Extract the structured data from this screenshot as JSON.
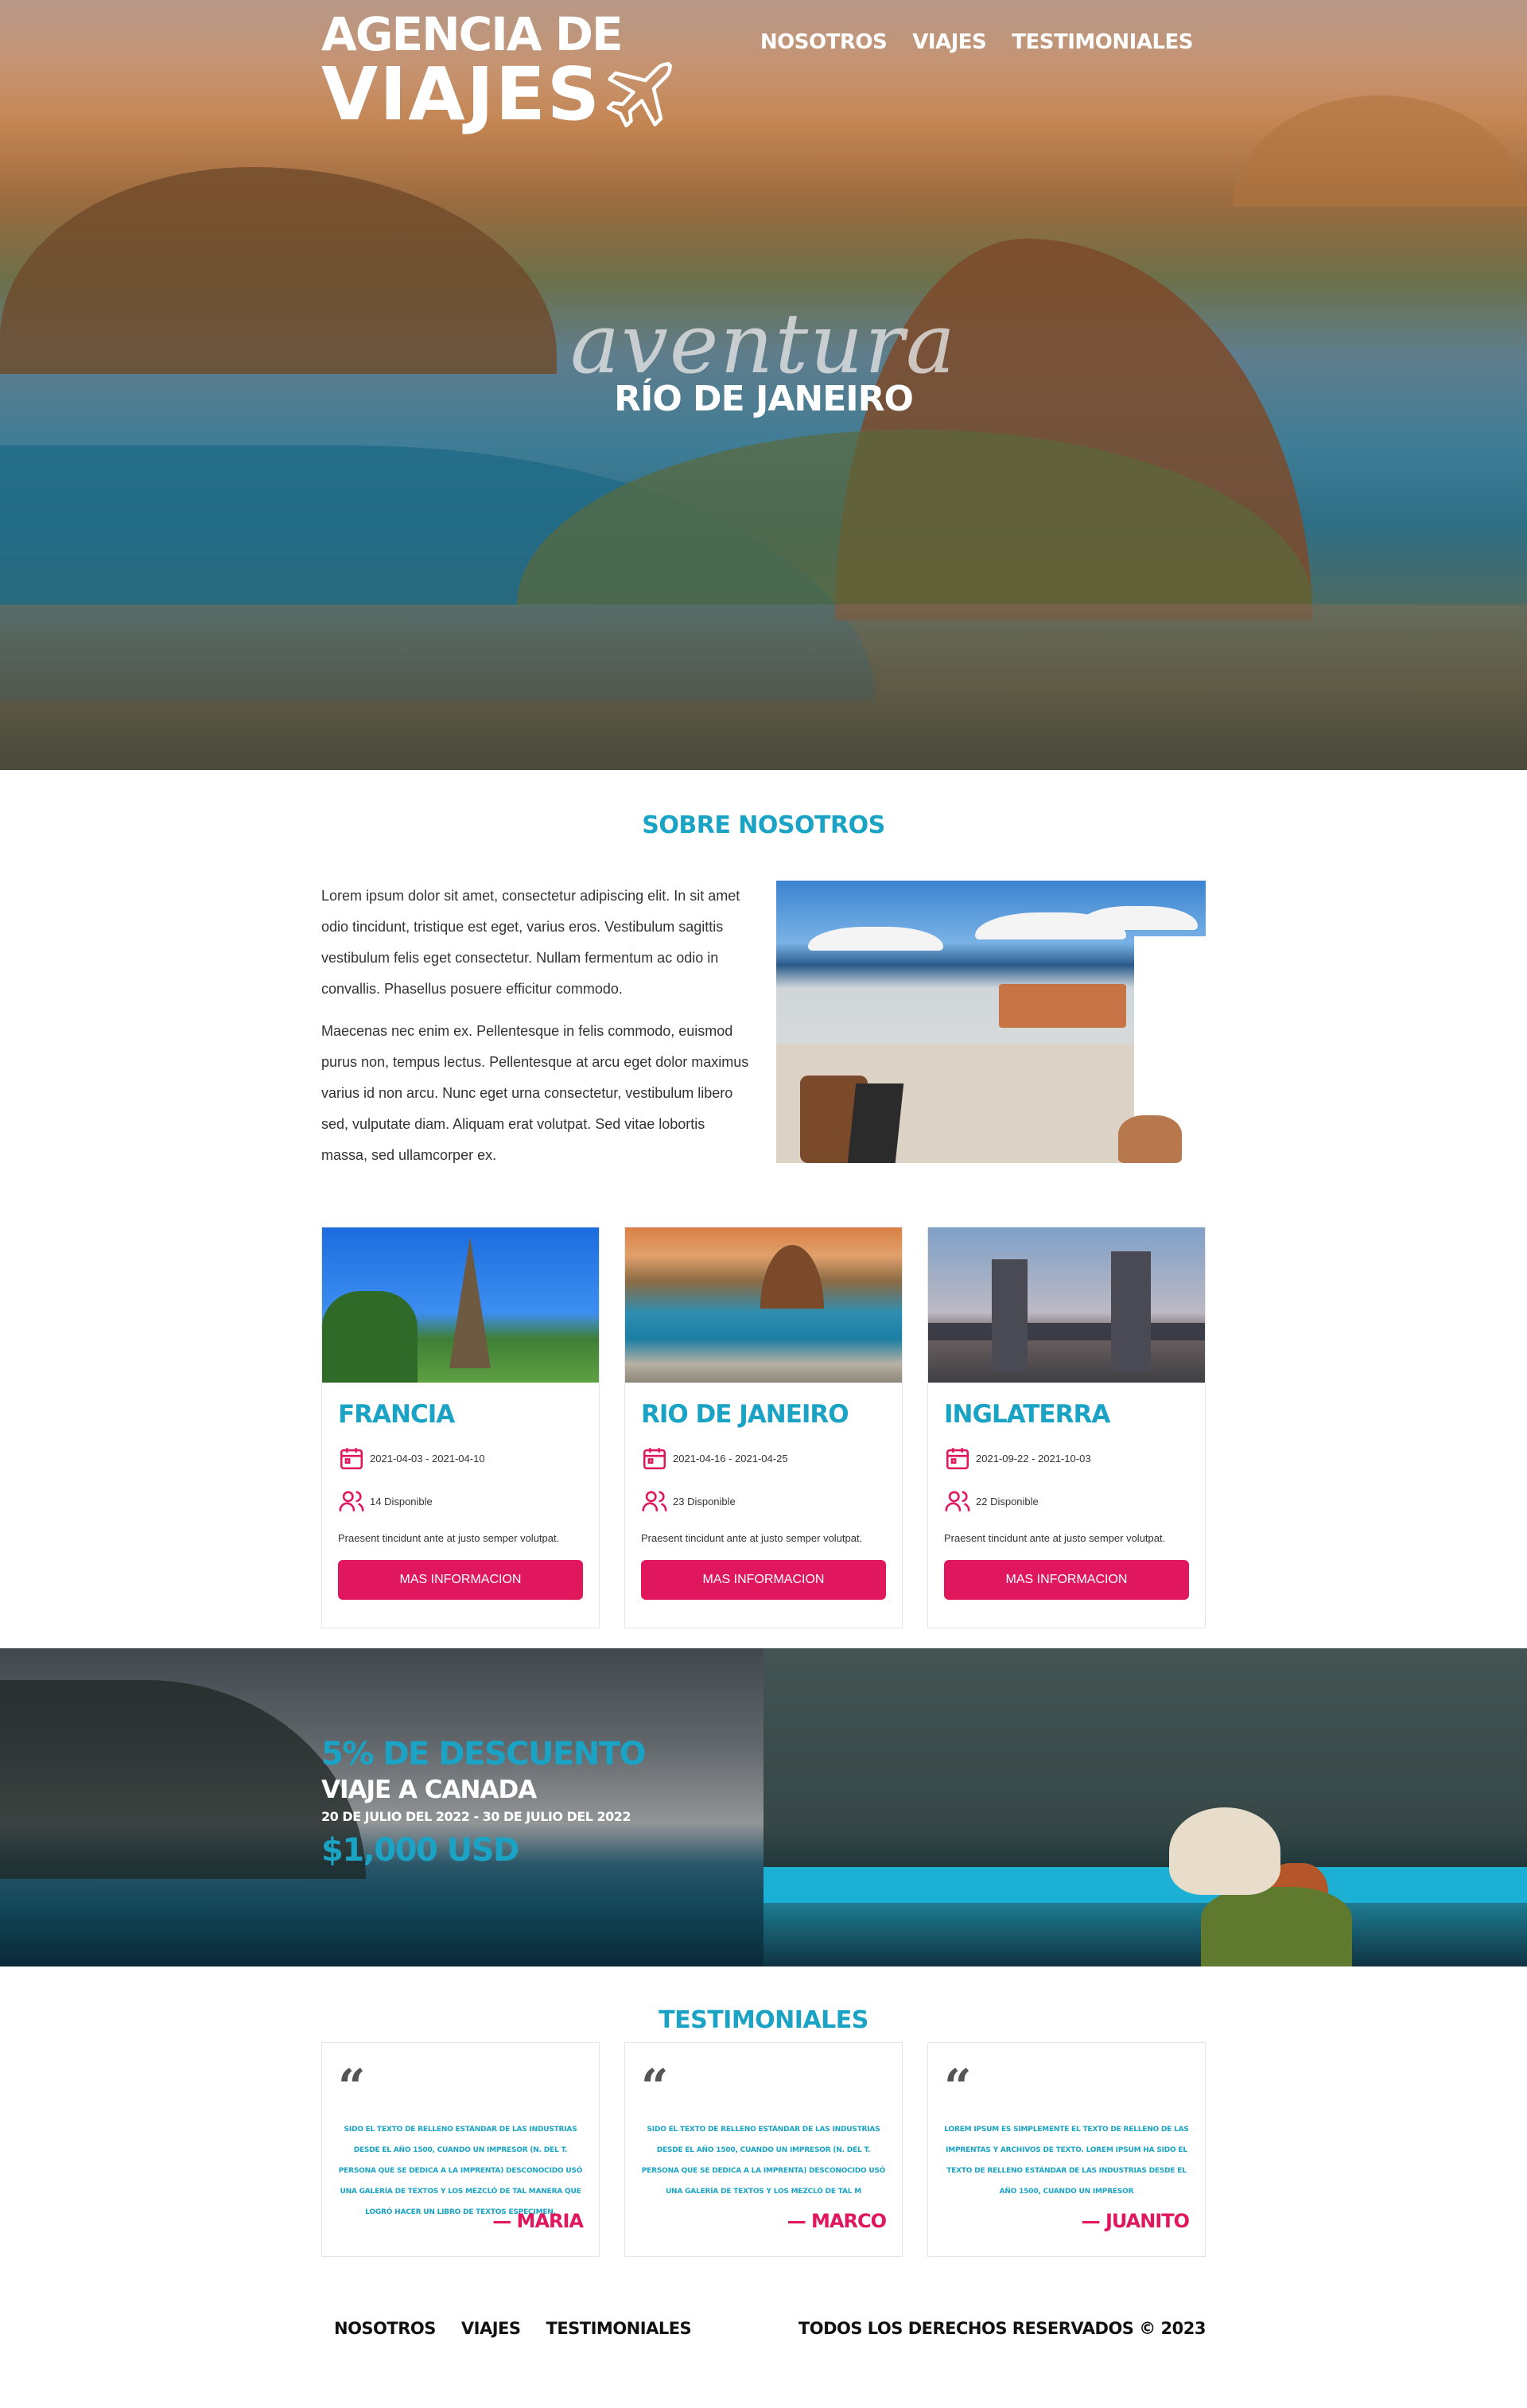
{
  "brand": {
    "line1": "AGENCIA DE",
    "line2": "VIAJES",
    "icon": "airplane-icon"
  },
  "nav": {
    "items": [
      "NOSOTROS",
      "VIAJES",
      "TESTIMONIALES"
    ]
  },
  "hero": {
    "script": "aventura",
    "city": "RÍO DE JANEIRO"
  },
  "about": {
    "title": "SOBRE NOSOTROS",
    "paragraphs": [
      "Lorem ipsum dolor sit amet, consectetur adipiscing elit. In sit amet odio tincidunt, tristique est eget, varius eros. Vestibulum sagittis vestibulum felis eget consectetur. Nullam fermentum ac odio in convallis. Phasellus posuere efficitur commodo.",
      "Maecenas nec enim ex. Pellentesque in felis commodo, euismod purus non, tempus lectus. Pellentesque at arcu eget dolor maximus varius id non arcu. Nunc eget urna consectetur, vestibulum libero sed, vulputate diam. Aliquam erat volutpat. Sed vitae lobortis massa, sed ullamcorper ex."
    ]
  },
  "trips": [
    {
      "title": "FRANCIA",
      "dates": "2021-04-03 - 2021-04-10",
      "available": "14 Disponible",
      "description": "Praesent tincidunt ante at justo semper volutpat.",
      "button": "MAS INFORMACION"
    },
    {
      "title": "RIO DE JANEIRO",
      "dates": "2021-04-16 - 2021-04-25",
      "available": "23 Disponible",
      "description": "Praesent tincidunt ante at justo semper volutpat.",
      "button": "MAS INFORMACION"
    },
    {
      "title": "INGLATERRA",
      "dates": "2021-09-22 - 2021-10-03",
      "available": "22 Disponible",
      "description": "Praesent tincidunt ante at justo semper volutpat.",
      "button": "MAS INFORMACION"
    }
  ],
  "promo": {
    "discount": "5% DE DESCUENTO",
    "destination": "VIAJE A CANADA",
    "dates": "20 DE JULIO DEL 2022 - 30 DE JULIO DEL 2022",
    "price": "$1,000 USD"
  },
  "testimonials": {
    "title": "TESTIMONIALES",
    "items": [
      {
        "quote_mark": "“",
        "text": "SIDO EL TEXTO DE RELLENO ESTÁNDAR DE LAS INDUSTRIAS DESDE EL AÑO 1500, CUANDO UN IMPRESOR (N. DEL T. PERSONA QUE SE DEDICA A LA IMPRENTA) DESCONOCIDO USÓ UNA GALERÍA DE TEXTOS Y LOS MEZCLÓ DE TAL MANERA QUE LOGRÓ HACER UN LIBRO DE TEXTOS ESPECIMEN.",
        "author": "— MARIA"
      },
      {
        "quote_mark": "“",
        "text": "SIDO EL TEXTO DE RELLENO ESTÁNDAR DE LAS INDUSTRIAS DESDE EL AÑO 1500, CUANDO UN IMPRESOR (N. DEL T. PERSONA QUE SE DEDICA A LA IMPRENTA) DESCONOCIDO USÓ UNA GALERÍA DE TEXTOS Y LOS MEZCLÓ DE TAL M",
        "author": "— MARCO"
      },
      {
        "quote_mark": "“",
        "text": "LOREM IPSUM ES SIMPLEMENTE EL TEXTO DE RELLENO DE LAS IMPRENTAS Y ARCHIVOS DE TEXTO. LOREM IPSUM HA SIDO EL TEXTO DE RELLENO ESTÁNDAR DE LAS INDUSTRIAS DESDE EL AÑO 1500, CUANDO UN IMPRESOR",
        "author": "— JUANITO"
      }
    ]
  },
  "footer": {
    "nav": [
      "NOSOTROS",
      "VIAJES",
      "TESTIMONIALES"
    ],
    "copyright": "TODOS LOS DERECHOS RESERVADOS © 2023"
  },
  "colors": {
    "accent": "#1aa3c4",
    "button": "#e0175d",
    "author": "#e0175d"
  }
}
